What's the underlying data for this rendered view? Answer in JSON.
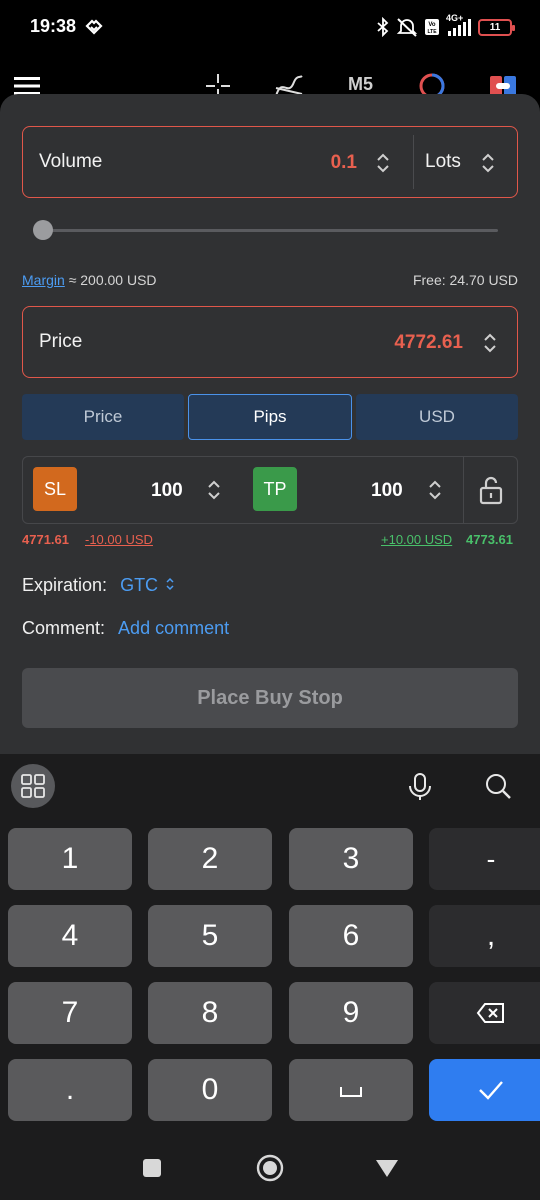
{
  "status_bar": {
    "time": "19:38",
    "icons": [
      "heart-icon",
      "bluetooth-icon",
      "mute-icon",
      "volte-icon",
      "signal-icon",
      "battery-icon"
    ],
    "network": "4G+",
    "battery": "11"
  },
  "toolbar": {
    "icons": [
      "menu-icon",
      "crosshair-icon",
      "indicator-icon",
      "theme-icon",
      "trade-icon"
    ],
    "timeframe": "M5"
  },
  "order": {
    "volume_label": "Volume",
    "volume_value": "0.1",
    "volume_unit": "Lots",
    "volume_fraction": 0.0,
    "margin_label": "Margin",
    "margin_value": "≈ 200.00 USD",
    "free_label": "Free:",
    "free_value": "24.70 USD",
    "price_label": "Price",
    "price_value": "4772.61",
    "tabs": [
      "Price",
      "Pips",
      "USD"
    ],
    "active_tab": "Pips",
    "sl_label": "SL",
    "sl_value": "100",
    "tp_label": "TP",
    "tp_value": "100",
    "sl_price": "4771.61",
    "sl_usd": "-10.00 USD",
    "tp_usd": "+10.00 USD",
    "tp_price": "4773.61",
    "expiration_label": "Expiration:",
    "expiration_value": "GTC",
    "comment_label": "Comment:",
    "comment_link": "Add comment",
    "submit_label": "Place Buy Stop"
  },
  "colors": {
    "accent_red": "#e8604f",
    "accent_green": "#49c06a",
    "accent_blue": "#4c9cf2",
    "sl_badge": "#d2691e",
    "tp_badge": "#3a9a4a",
    "enter_key": "#2f7df0"
  },
  "keyboard": {
    "keys": [
      "1",
      "2",
      "3",
      "-",
      "4",
      "5",
      "6",
      ",",
      "7",
      "8",
      "9",
      "backspace",
      ".",
      "0",
      "space",
      "enter"
    ],
    "row1": [
      "1",
      "2",
      "3",
      "-"
    ],
    "row2": [
      "4",
      "5",
      "6",
      ","
    ],
    "row3": [
      "7",
      "8",
      "9"
    ],
    "row4": [
      ".",
      "0"
    ]
  }
}
